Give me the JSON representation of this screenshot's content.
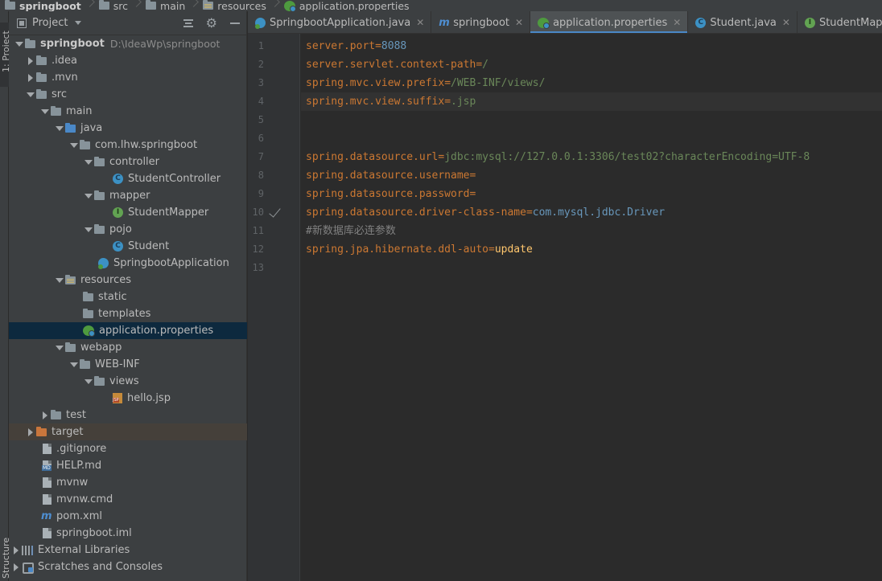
{
  "breadcrumb": [
    {
      "label": "springboot",
      "icon": "folder-icon"
    },
    {
      "label": "src",
      "icon": "folder-icon"
    },
    {
      "label": "main",
      "icon": "folder-icon"
    },
    {
      "label": "resources",
      "icon": "resources-folder-icon"
    },
    {
      "label": "application.properties",
      "icon": "spring-properties-icon"
    }
  ],
  "tool_strip": {
    "project_tab": "1: Project",
    "structure_tab": "Structure"
  },
  "project_panel": {
    "title": "Project",
    "root_name": "springboot",
    "root_path": "D:\\IdeaWp\\springboot",
    "items": [
      {
        "label": ".idea"
      },
      {
        "label": ".mvn"
      },
      {
        "label": "src"
      },
      {
        "label": "main"
      },
      {
        "label": "java"
      },
      {
        "label": "com.lhw.springboot"
      },
      {
        "label": "controller"
      },
      {
        "label": "StudentController"
      },
      {
        "label": "mapper"
      },
      {
        "label": "StudentMapper"
      },
      {
        "label": "pojo"
      },
      {
        "label": "Student"
      },
      {
        "label": "SpringbootApplication"
      },
      {
        "label": "resources"
      },
      {
        "label": "static"
      },
      {
        "label": "templates"
      },
      {
        "label": "application.properties"
      },
      {
        "label": "webapp"
      },
      {
        "label": "WEB-INF"
      },
      {
        "label": "views"
      },
      {
        "label": "hello.jsp"
      },
      {
        "label": "test"
      },
      {
        "label": "target"
      },
      {
        "label": ".gitignore"
      },
      {
        "label": "HELP.md"
      },
      {
        "label": "mvnw"
      },
      {
        "label": "mvnw.cmd"
      },
      {
        "label": "pom.xml"
      },
      {
        "label": "springboot.iml"
      },
      {
        "label": "External Libraries"
      },
      {
        "label": "Scratches and Consoles"
      }
    ]
  },
  "tabs": [
    {
      "label": "SpringbootApplication.java"
    },
    {
      "label": "springboot"
    },
    {
      "label": "application.properties"
    },
    {
      "label": "Student.java"
    },
    {
      "label": "StudentMapper.java"
    }
  ],
  "editor": {
    "line_numbers": [
      "1",
      "2",
      "3",
      "4",
      "5",
      "6",
      "7",
      "8",
      "9",
      "10",
      "11",
      "12",
      "13"
    ],
    "lines": [
      {
        "key": "server.port",
        "eq": "=",
        "value": "8088"
      },
      {
        "key": "server.servlet.context-path",
        "eq": "=",
        "value": "/"
      },
      {
        "key": "spring.mvc.view.prefix",
        "eq": "=",
        "value": "/WEB-INF/views/"
      },
      {
        "key": "spring.mvc.view.suffix",
        "eq": "=",
        "value": ".jsp"
      },
      {
        "key": "",
        "eq": "",
        "value": ""
      },
      {
        "key": "",
        "eq": "",
        "value": ""
      },
      {
        "key": "spring.datasource.url",
        "eq": "=",
        "value": "jdbc:mysql://127.0.0.1:3306/test02?characterEncoding=UTF-8"
      },
      {
        "key": "spring.datasource.username",
        "eq": "=",
        "value": ""
      },
      {
        "key": "spring.datasource.password",
        "eq": "=",
        "value": ""
      },
      {
        "key": "spring.datasource.driver-class-name",
        "eq": "=",
        "value": "com.mysql.jdbc.Driver"
      },
      {
        "comment": "#新数据库必连参数"
      },
      {
        "key": "spring.jpa.hibernate.ddl-auto",
        "eq": "=",
        "value": "update"
      },
      {
        "key": "",
        "eq": "",
        "value": ""
      }
    ]
  },
  "colors": {
    "key": "#cc7832",
    "value_green": "#6a8759",
    "value_number": "#6897bb",
    "value_yellow": "#ffc66d",
    "selection": "#0d293e",
    "accent": "#4a88c7"
  }
}
